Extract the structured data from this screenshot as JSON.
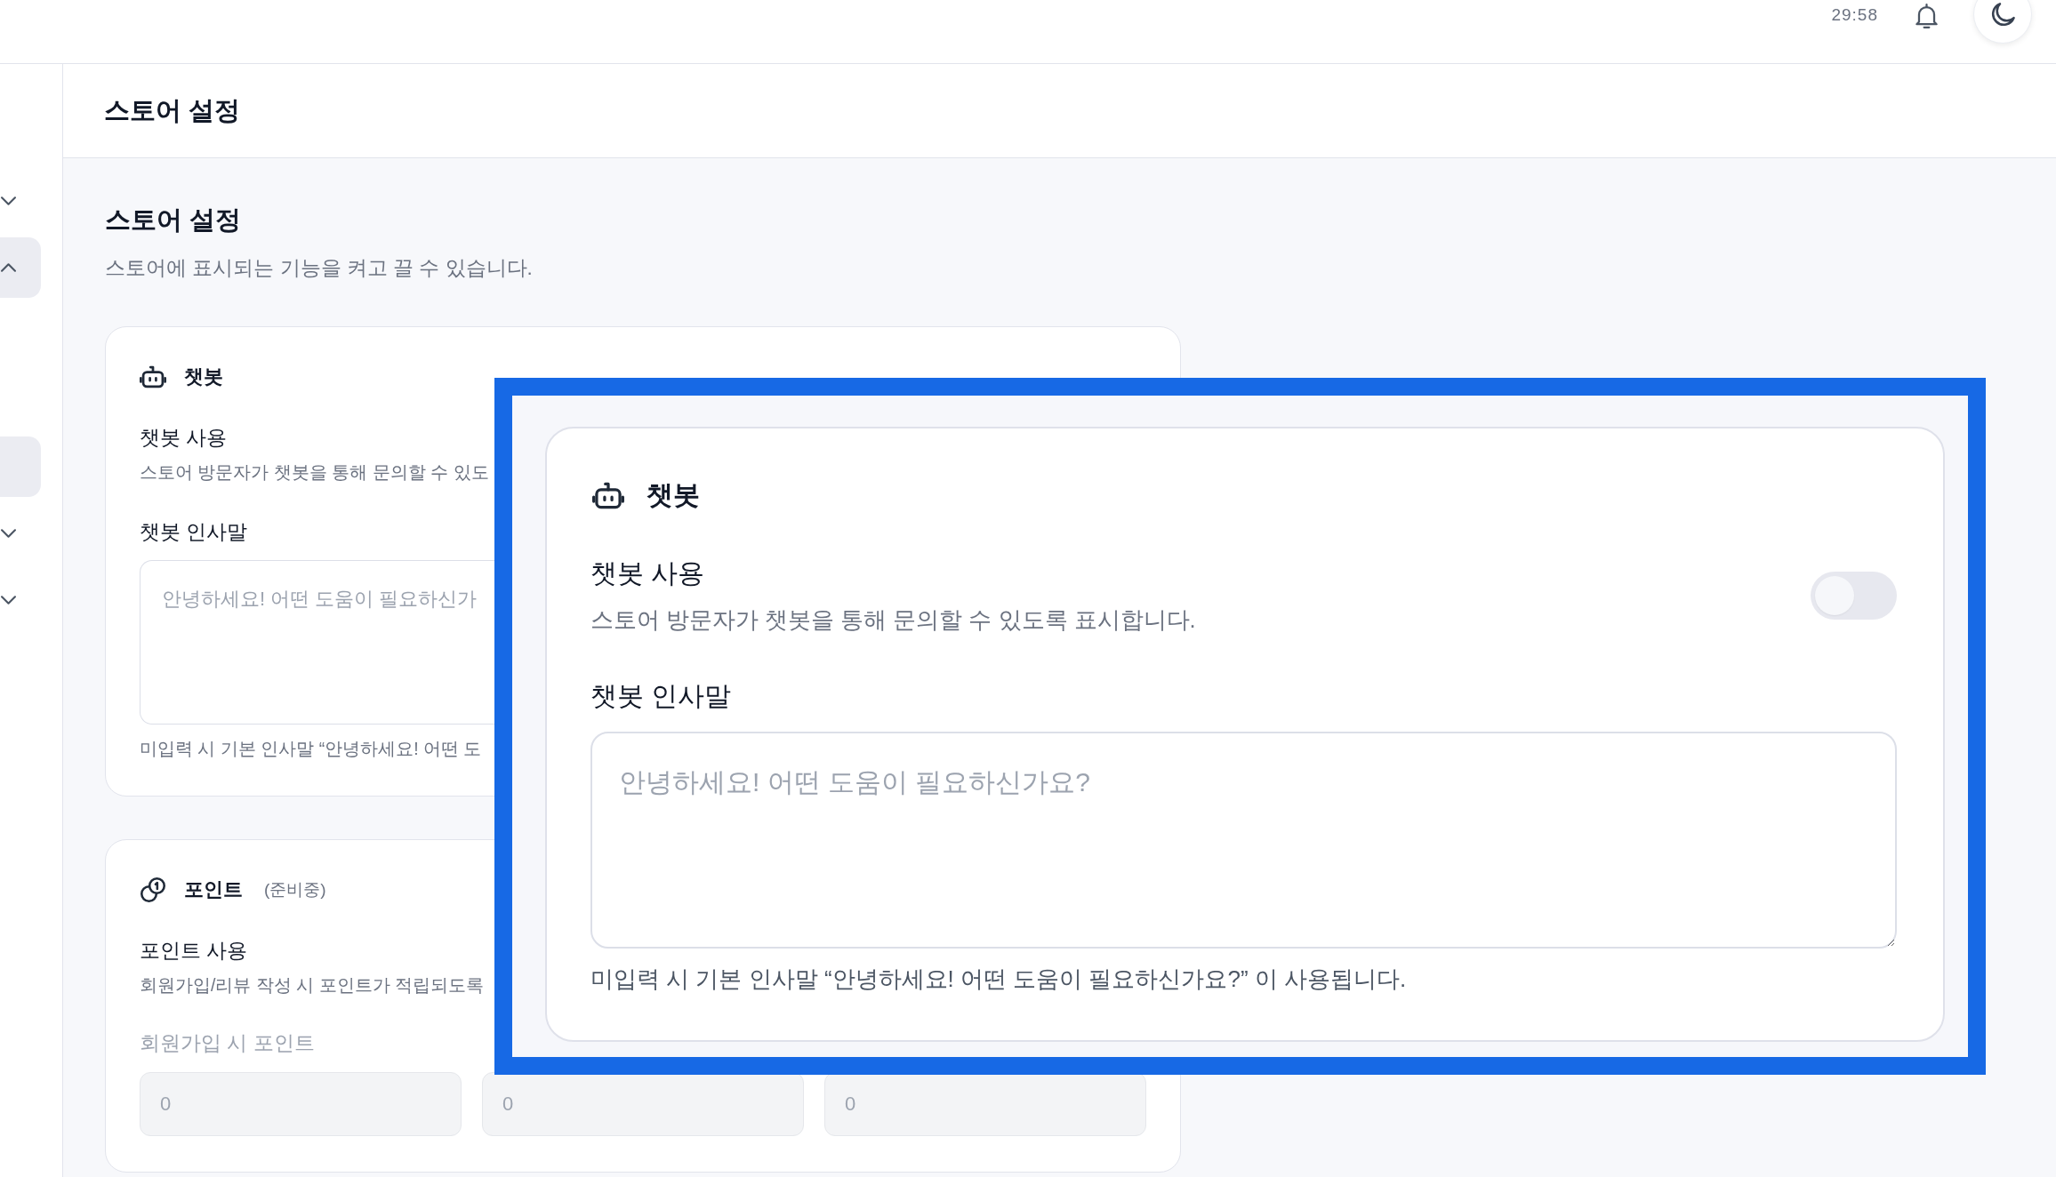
{
  "top_bar": {
    "timer": "29:58"
  },
  "sidebar": {
    "items": [
      {
        "kind": "group",
        "expanded": false,
        "selected": false
      },
      {
        "kind": "group",
        "expanded": true,
        "selected": true
      },
      {
        "kind": "link",
        "selected": true
      },
      {
        "kind": "group",
        "expanded": false,
        "selected": false
      },
      {
        "kind": "group",
        "expanded": false,
        "selected": false
      }
    ]
  },
  "page_header": {
    "title": "스토어 설정"
  },
  "section": {
    "title": "스토어 설정",
    "description": "스토어에 표시되는 기능을 켜고 끌 수 있습니다."
  },
  "chatbot_card": {
    "title": "챗봇",
    "enable_label": "챗봇 사용",
    "enable_description": "스토어 방문자가 챗봇을 통해 문의할 수 있도",
    "greeting_label": "챗봇 인사말",
    "greeting_placeholder": "안녕하세요! 어떤 도움이 필요하신가",
    "greeting_help": "미입력 시 기본 인사말 “안녕하세요! 어떤 도"
  },
  "points_card": {
    "title": "포인트",
    "status": "(준비중)",
    "enable_label": "포인트 사용",
    "enable_description": "회원가입/리뷰 작성 시 포인트가 적립되도록",
    "fields": [
      {
        "label": "회원가입 시 포인트",
        "value": "0",
        "disabled": true
      },
      {
        "value": "0",
        "disabled": true
      },
      {
        "value": "0",
        "disabled": true
      }
    ]
  },
  "callout": {
    "title": "챗봇",
    "enable_label": "챗봇 사용",
    "enable_description": "스토어 방문자가 챗봇을 통해 문의할 수 있도록 표시합니다.",
    "enable_toggle": {
      "on": false
    },
    "greeting_label": "챗봇 인사말",
    "greeting_placeholder": "안녕하세요! 어떤 도움이 필요하신가요?",
    "greeting_help": "미입력 시 기본 인사말 “안녕하세요! 어떤 도움이 필요하신가요?” 이 사용됩니다."
  }
}
